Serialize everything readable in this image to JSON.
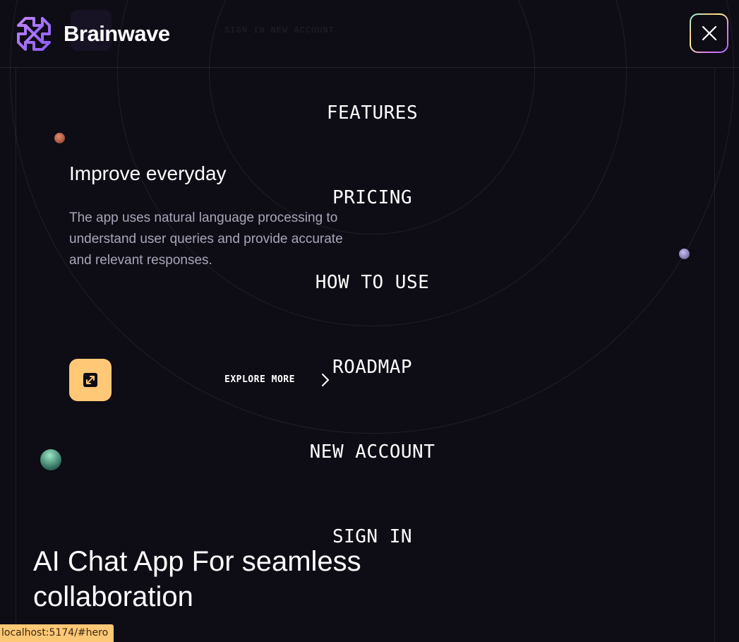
{
  "header": {
    "logo_text": "Brainwave",
    "ghost_nav_text": "SIGN IN  NEW ACCOUNT"
  },
  "nav": {
    "items": [
      {
        "label": "FEATURES"
      },
      {
        "label": "PRICING"
      },
      {
        "label": "HOW TO USE"
      },
      {
        "label": "ROADMAP"
      },
      {
        "label": "NEW ACCOUNT"
      },
      {
        "label": "SIGN IN"
      }
    ]
  },
  "feature": {
    "title": "Improve everyday",
    "description": "The app uses natural language processing to understand user queries and provide accurate and relevant responses.",
    "explore_label": "EXPLORE MORE"
  },
  "hero": {
    "title": "AI Chat App For seamless collaboration"
  },
  "status_bar": {
    "url": "localhost:5174/#hero"
  },
  "colors": {
    "background": "#0e0c15",
    "accent_yellow": "#ffc876",
    "brand_purple": "#ac6aff",
    "text_muted": "#a9a6b8"
  }
}
